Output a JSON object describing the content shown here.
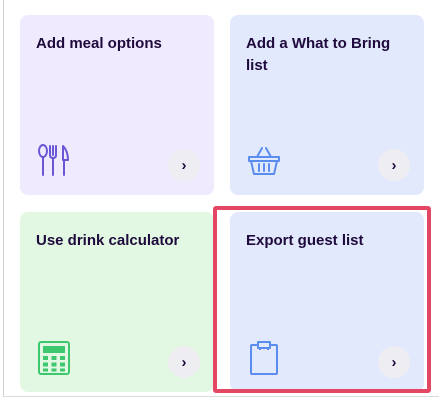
{
  "cards": [
    {
      "title": "Add meal options",
      "icon": "utensils-icon",
      "arrow": "›"
    },
    {
      "title": "Add a What to Bring list",
      "icon": "basket-icon",
      "arrow": "›"
    },
    {
      "title": "Use drink calculator",
      "icon": "calculator-icon",
      "arrow": "›"
    },
    {
      "title": "Export guest list",
      "icon": "clipboard-icon",
      "arrow": "›"
    }
  ],
  "colors": {
    "meal_bg": "#efeafd",
    "bring_bg": "#e3e9fd",
    "drink_bg": "#e2f8e3",
    "export_bg": "#e3e9fd",
    "meal_icon": "#6b57d6",
    "bring_icon": "#5b8cf0",
    "drink_icon": "#3dc870",
    "export_icon": "#5b8cf0",
    "highlight": "#e44764",
    "title_text": "#1e0a3c"
  }
}
